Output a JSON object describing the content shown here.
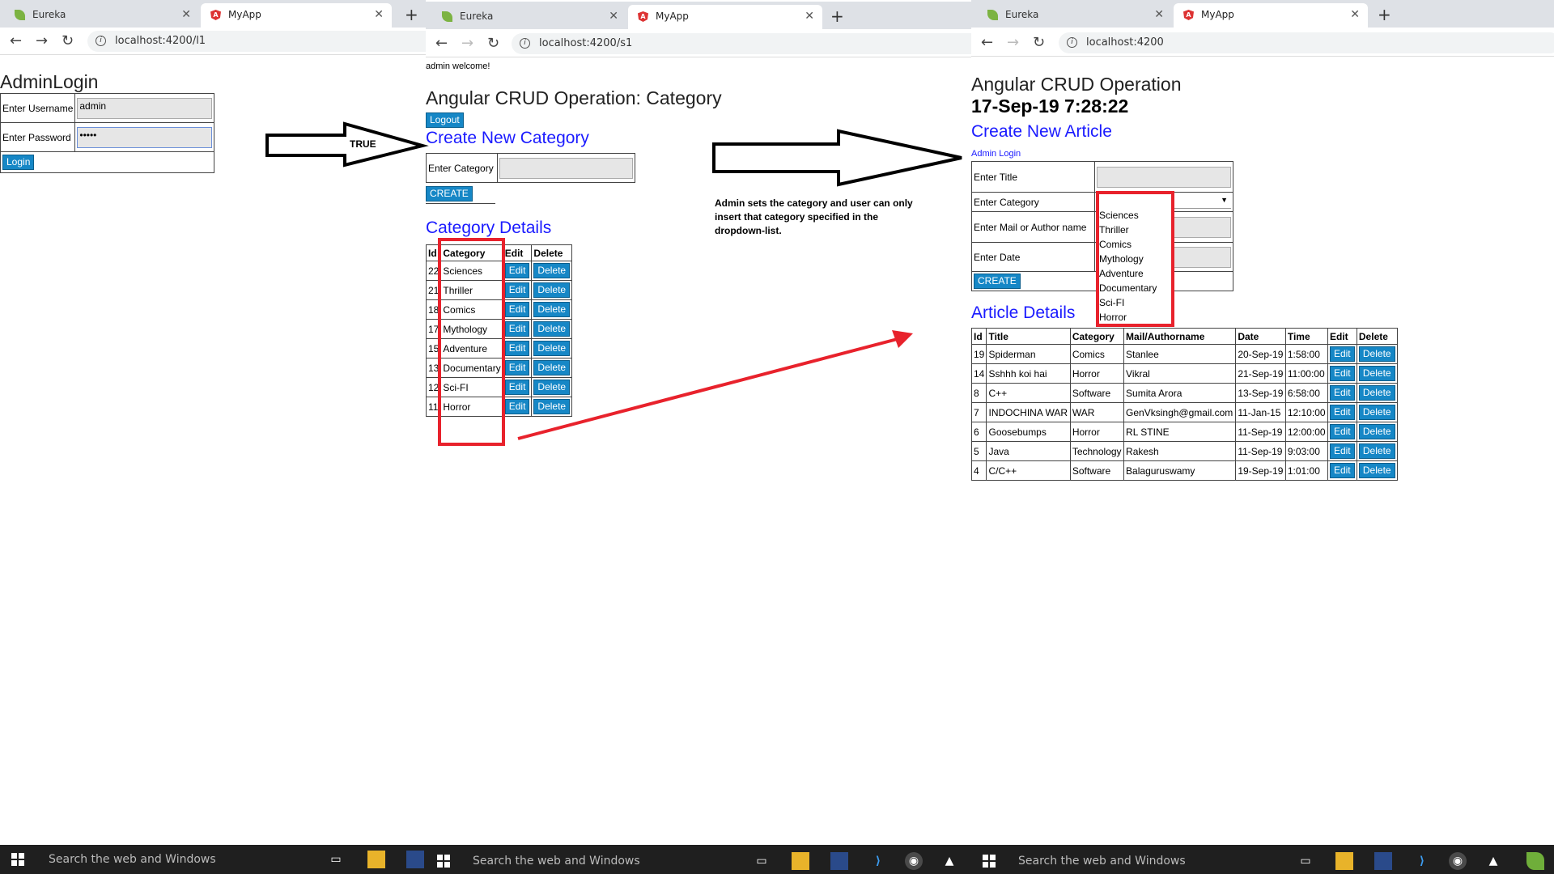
{
  "left": {
    "tabs": [
      {
        "label": "Eureka"
      },
      {
        "label": "MyApp"
      }
    ],
    "url": "localhost:4200/l1",
    "title": "AdminLogin",
    "username_label": "Enter Username",
    "username_value": "admin",
    "password_label": "Enter Password",
    "password_value": "•••••",
    "login_btn": "Login"
  },
  "arrow1_label": "TRUE",
  "middle": {
    "tabs": [
      {
        "label": "Eureka"
      },
      {
        "label": "MyApp"
      }
    ],
    "url": "localhost:4200/s1",
    "welcome": "admin welcome!",
    "title": "Angular CRUD Operation: Category",
    "logout_btn": "Logout",
    "create_heading": "Create New Category",
    "category_label": "Enter Category",
    "create_btn": "CREATE",
    "details_heading": "Category Details",
    "columns": [
      "Id",
      "Category",
      "Edit",
      "Delete"
    ],
    "rows": [
      {
        "id": "22",
        "category": "Sciences"
      },
      {
        "id": "21",
        "category": "Thriller"
      },
      {
        "id": "18",
        "category": "Comics"
      },
      {
        "id": "17",
        "category": "Mythology"
      },
      {
        "id": "15",
        "category": "Adventure"
      },
      {
        "id": "13",
        "category": "Documentary"
      },
      {
        "id": "12",
        "category": "Sci-FI"
      },
      {
        "id": "11",
        "category": "Horror"
      }
    ],
    "edit_label": "Edit",
    "delete_label": "Delete"
  },
  "note": "Admin sets the category and user can only insert that category specified in the dropdown-list.",
  "right": {
    "tabs": [
      {
        "label": "Eureka"
      },
      {
        "label": "MyApp"
      }
    ],
    "url": "localhost:4200",
    "title": "Angular CRUD Operation",
    "datetime": "17-Sep-19 7:28:22",
    "create_heading": "Create New Article",
    "admin_link": "Admin Login",
    "title_label": "Enter Title",
    "category_label": "Enter Category",
    "mail_label": "Enter Mail or Author name",
    "date_label": "Enter Date",
    "create_btn": "CREATE",
    "dropdown_options": [
      "Sciences",
      "Thriller",
      "Comics",
      "Mythology",
      "Adventure",
      "Documentary",
      "Sci-FI",
      "Horror"
    ],
    "details_heading": "Article Details",
    "columns": [
      "Id",
      "Title",
      "Category",
      "Mail/Authorname",
      "Date",
      "Time",
      "Edit",
      "Delete"
    ],
    "rows": [
      {
        "id": "19",
        "title": "Spiderman",
        "category": "Comics",
        "mail": "Stanlee",
        "date": "20-Sep-19",
        "time": "1:58:00"
      },
      {
        "id": "14",
        "title": "Sshhh koi hai",
        "category": "Horror",
        "mail": "Vikral",
        "date": "21-Sep-19",
        "time": "11:00:00"
      },
      {
        "id": "8",
        "title": "C++",
        "category": "Software",
        "mail": "Sumita Arora",
        "date": "13-Sep-19",
        "time": "6:58:00"
      },
      {
        "id": "7",
        "title": "INDOCHINA WAR",
        "category": "WAR",
        "mail": "GenVksingh@gmail.com",
        "date": "11-Jan-15",
        "time": "12:10:00"
      },
      {
        "id": "6",
        "title": "Goosebumps",
        "category": "Horror",
        "mail": "RL STINE",
        "date": "11-Sep-19",
        "time": "12:00:00"
      },
      {
        "id": "5",
        "title": "Java",
        "category": "Technology",
        "mail": "Rakesh",
        "date": "11-Sep-19",
        "time": "9:03:00"
      },
      {
        "id": "4",
        "title": "C/C++",
        "category": "Software",
        "mail": "Balaguruswamy",
        "date": "19-Sep-19",
        "time": "1:01:00"
      }
    ],
    "edit_label": "Edit",
    "delete_label": "Delete"
  },
  "taskbar": {
    "search_text": "Search the web and Windows"
  },
  "colors": {
    "accent_blue": "#1687c6",
    "heading_blue": "#1a1aff",
    "highlight_red": "#e8222c",
    "taskbar": "#1f1f1f"
  }
}
